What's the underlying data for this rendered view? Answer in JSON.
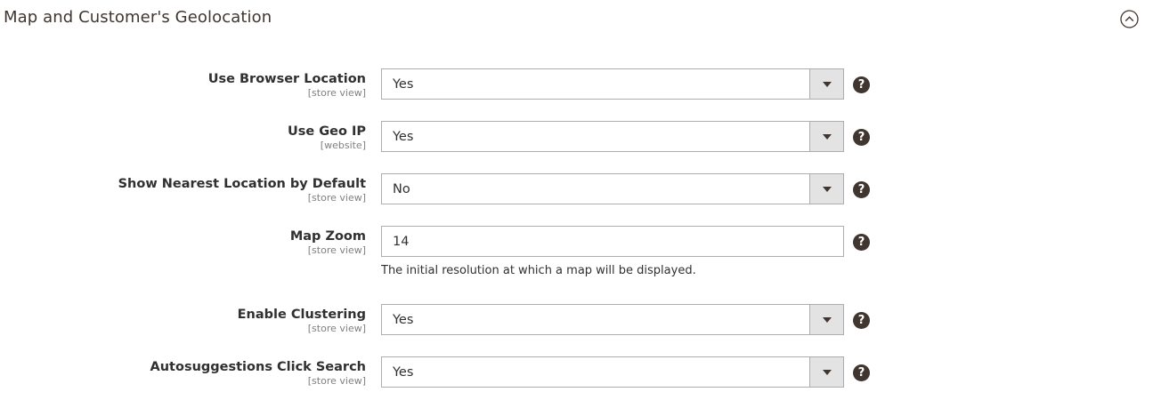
{
  "section": {
    "title": "Map and Customer's Geolocation",
    "collapse_icon": "collapse-circle-chevron-up-icon"
  },
  "fields": [
    {
      "label": "Use Browser Location",
      "scope": "[store view]",
      "type": "select",
      "value": "Yes"
    },
    {
      "label": "Use Geo IP",
      "scope": "[website]",
      "type": "select",
      "value": "Yes"
    },
    {
      "label": "Show Nearest Location by Default",
      "scope": "[store view]",
      "type": "select",
      "value": "No"
    },
    {
      "label": "Map Zoom",
      "scope": "[store view]",
      "type": "text",
      "value": "14",
      "note": "The initial resolution at which a map will be displayed."
    },
    {
      "label": "Enable Clustering",
      "scope": "[store view]",
      "type": "select",
      "value": "Yes"
    },
    {
      "label": "Autosuggestions Click Search",
      "scope": "[store view]",
      "type": "select",
      "value": "Yes"
    }
  ],
  "help_icon": {
    "glyph": "?",
    "name": "help-question-icon"
  },
  "colors": {
    "text": "#303030",
    "title": "#41362f",
    "border": "#adadad",
    "arrow_bg": "#e3e3e3",
    "help_bg": "#41362f"
  }
}
